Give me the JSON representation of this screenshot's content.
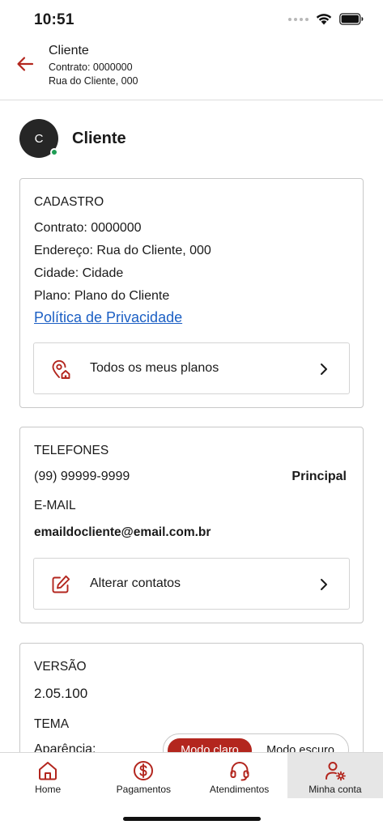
{
  "status": {
    "time": "10:51"
  },
  "header": {
    "title": "Cliente",
    "contract": "Contrato: 0000000",
    "address": "Rua do Cliente, 000"
  },
  "profile": {
    "initial": "C",
    "name": "Cliente"
  },
  "cadastro": {
    "title": "CADASTRO",
    "contract": "Contrato: 0000000",
    "address": "Endereço: Rua do Cliente, 000",
    "city": "Cidade: Cidade",
    "plan": "Plano: Plano do Cliente",
    "privacy_link": "Política de Privacidade",
    "plans_button": "Todos os meus planos"
  },
  "contacts": {
    "phones_title": "TELEFONES",
    "phone": "(99) 99999-9999",
    "phone_tag": "Principal",
    "email_title": "E-MAIL",
    "email": "emaildocliente@email.com.br",
    "edit_button": "Alterar contatos"
  },
  "app": {
    "version_title": "VERSÃO",
    "version": "2.05.100",
    "theme_title": "TEMA",
    "appearance_label": "Aparência:",
    "light_mode": "Modo claro",
    "dark_mode": "Modo escuro"
  },
  "nav": {
    "items": [
      {
        "label": "Home",
        "icon": "home-icon"
      },
      {
        "label": "Pagamentos",
        "icon": "dollar-circle-icon"
      },
      {
        "label": "Atendimentos",
        "icon": "headset-icon"
      },
      {
        "label": "Minha conta",
        "icon": "user-settings-icon"
      }
    ],
    "active_index": 3
  },
  "colors": {
    "accent": "#b3261e",
    "link": "#1b5fc4",
    "online": "#1f9d55"
  }
}
